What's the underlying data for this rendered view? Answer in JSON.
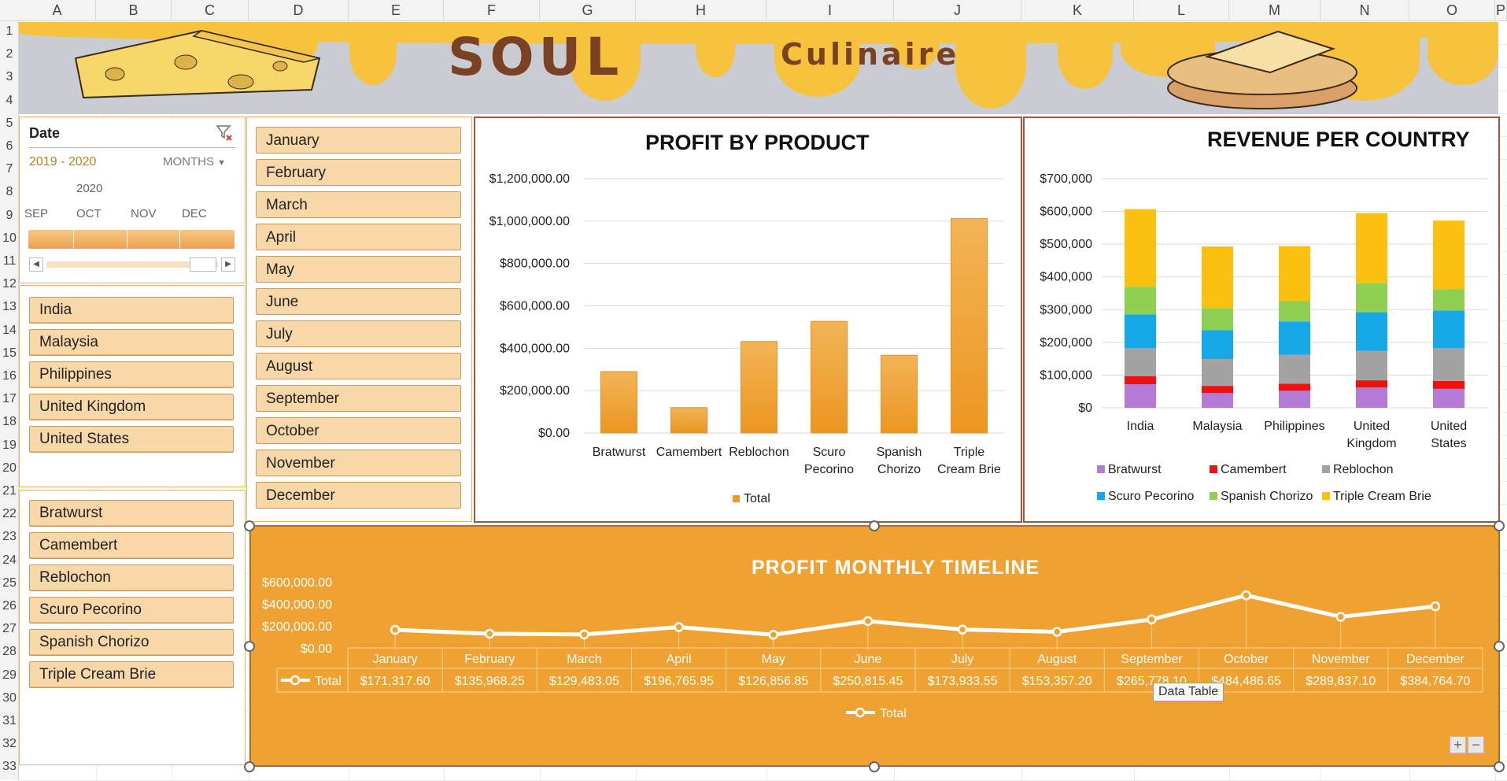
{
  "columns": [
    "A",
    "B",
    "C",
    "D",
    "E",
    "F",
    "G",
    "H",
    "I",
    "J",
    "K",
    "L",
    "M",
    "N",
    "O",
    "P"
  ],
  "rows": [
    "1",
    "2",
    "3",
    "4",
    "5",
    "6",
    "7",
    "8",
    "9",
    "10",
    "11",
    "12",
    "13",
    "14",
    "15",
    "16",
    "17",
    "18",
    "19",
    "20",
    "21",
    "22",
    "23",
    "24",
    "25",
    "26",
    "27",
    "28",
    "29",
    "30",
    "31",
    "32",
    "33"
  ],
  "banner": {
    "title_main": "SOUL",
    "title_sub": "Culinaire",
    "colors": {
      "yellow": "#f7c23e",
      "grey": "#c9cdd3",
      "brown": "#7a4123"
    }
  },
  "timeline": {
    "title": "Date",
    "filter_icon": "clear-filter-icon",
    "range": "2019 - 2020",
    "level": "MONTHS",
    "year": "2020",
    "months": [
      "SEP",
      "OCT",
      "NOV",
      "DEC"
    ]
  },
  "country_slicer": {
    "items": [
      "India",
      "Malaysia",
      "Philippines",
      "United Kingdom",
      "United States"
    ]
  },
  "product_slicer": {
    "items": [
      "Bratwurst",
      "Camembert",
      "Reblochon",
      "Scuro Pecorino",
      "Spanish Chorizo",
      "Triple Cream Brie"
    ]
  },
  "month_slicer": {
    "items": [
      "January",
      "February",
      "March",
      "April",
      "May",
      "June",
      "July",
      "August",
      "September",
      "October",
      "November",
      "December"
    ]
  },
  "profit_by_product": {
    "title": "PROFIT BY PRODUCT",
    "legend": "Total",
    "chart_data": {
      "type": "bar",
      "categories": [
        "Bratwurst",
        "Camembert",
        "Reblochon",
        "Scuro Pecorino",
        "Spanish Chorizo",
        "Triple Cream Brie"
      ],
      "category_lines": [
        [
          "Bratwurst"
        ],
        [
          "Camembert"
        ],
        [
          "Reblochon"
        ],
        [
          "Scuro",
          "Pecorino"
        ],
        [
          "Spanish",
          "Chorizo"
        ],
        [
          "Triple",
          "Cream Brie"
        ]
      ],
      "values": [
        290000,
        120000,
        432000,
        527000,
        367000,
        1012000
      ],
      "yticks": [
        "$0.00",
        "$200,000.00",
        "$400,000.00",
        "$600,000.00",
        "$800,000.00",
        "$1,000,000.00",
        "$1,200,000.00"
      ],
      "ylim": [
        0,
        1200000
      ],
      "color": "#ed9a24"
    }
  },
  "revenue_per_country": {
    "title": "REVENUE PER COUNTRY",
    "chart_data": {
      "type": "bar",
      "stacked": true,
      "categories": [
        "India",
        "Malaysia",
        "Philippines",
        "United Kingdom",
        "United States"
      ],
      "category_lines": [
        [
          "India"
        ],
        [
          "Malaysia"
        ],
        [
          "Philippines"
        ],
        [
          "United",
          "Kingdom"
        ],
        [
          "United",
          "States"
        ]
      ],
      "series": [
        {
          "name": "Bratwurst",
          "color": "#b57ad6",
          "values": [
            72000,
            45000,
            52000,
            62000,
            58000
          ]
        },
        {
          "name": "Camembert",
          "color": "#ef1010",
          "values": [
            25000,
            22000,
            22000,
            22000,
            24000
          ]
        },
        {
          "name": "Reblochon",
          "color": "#a3a3a3",
          "values": [
            85000,
            82000,
            88000,
            90000,
            100000
          ]
        },
        {
          "name": "Scuro Pecorino",
          "color": "#16a9ea",
          "values": [
            103000,
            88000,
            102000,
            118000,
            115000
          ]
        },
        {
          "name": "Spanish Chorizo",
          "color": "#8fcf52",
          "values": [
            85000,
            68000,
            62000,
            88000,
            65000
          ]
        },
        {
          "name": "Triple Cream Brie",
          "color": "#fbc010",
          "values": [
            237000,
            188000,
            168000,
            215000,
            210000
          ]
        }
      ],
      "yticks": [
        "$0",
        "$100,000",
        "$200,000",
        "$300,000",
        "$400,000",
        "$500,000",
        "$600,000",
        "$700,000"
      ],
      "ylim": [
        0,
        700000
      ]
    }
  },
  "profit_timeline": {
    "title": "PROFIT MONTHLY TIMELINE",
    "legend": "Total",
    "row_label": "Total",
    "tooltip": "Data Table",
    "chart_data": {
      "type": "line",
      "categories": [
        "January",
        "February",
        "March",
        "April",
        "May",
        "June",
        "July",
        "August",
        "September",
        "October",
        "November",
        "December"
      ],
      "values": [
        171317.6,
        135968.25,
        129483.05,
        196765.95,
        126856.85,
        250815.45,
        173933.55,
        153357.2,
        265778.1,
        484486.65,
        289837.1,
        384764.7
      ],
      "labels": [
        "$171,317.60",
        "$135,968.25",
        "$129,483.05",
        "$196,765.95",
        "$126,856.85",
        "$250,815.45",
        "$173,933.55",
        "$153,357.20",
        "$265,778.10",
        "$484,486.65",
        "$289,837.10",
        "$384,764.70"
      ],
      "yticks": [
        "$0.00",
        "$200,000.00",
        "$400,000.00",
        "$600,000.00"
      ],
      "ylim": [
        0,
        600000
      ]
    }
  },
  "zoom": {
    "plus": "+",
    "minus": "−"
  }
}
